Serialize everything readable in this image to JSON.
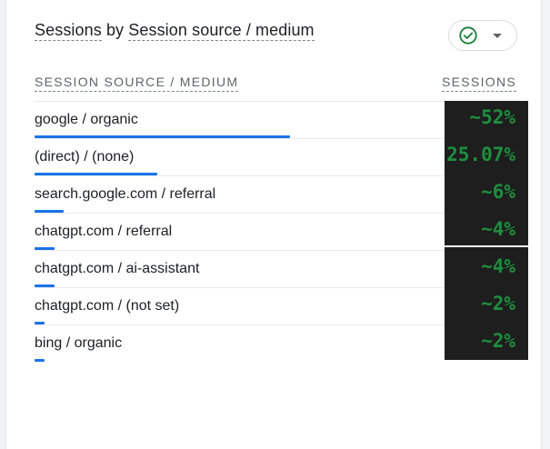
{
  "card": {
    "title_prefix": "Sessions",
    "title_by": " by ",
    "title_dimension": "Session source / medium"
  },
  "status": {
    "icon": "check-circle-icon",
    "caret": "chevron-down-icon",
    "color": "#188038"
  },
  "table": {
    "col_source": "SESSION SOURCE / MEDIUM",
    "col_sessions": "SESSIONS",
    "rows": [
      {
        "label": "google / organic",
        "value": "~52%",
        "share": 0.52
      },
      {
        "label": "(direct) / (none)",
        "value": "25.07%",
        "share": 0.2507
      },
      {
        "label": "search.google.com / referral",
        "value": "~6%",
        "share": 0.06
      },
      {
        "label": "chatgpt.com / referral",
        "value": "~4%",
        "share": 0.04
      },
      {
        "label": "chatgpt.com / ai-assistant",
        "value": "~4%",
        "share": 0.04
      },
      {
        "label": "chatgpt.com / (not set)",
        "value": "~2%",
        "share": 0.02
      },
      {
        "label": "bing / organic",
        "value": "~2%",
        "share": 0.02
      }
    ]
  },
  "colors": {
    "bar": "#1a73e8",
    "value_text": "#1e8e3e",
    "value_bg": "#1e1e1e"
  }
}
